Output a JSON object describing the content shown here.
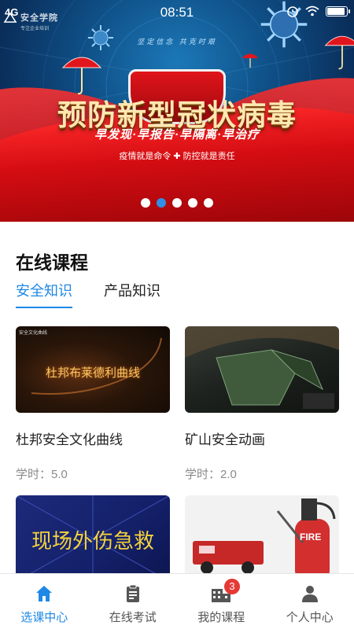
{
  "status_bar": {
    "signal": "4G",
    "time": "08:51"
  },
  "banner": {
    "logo_title": "安全学院",
    "logo_subtitle": "专注企业培训",
    "slogan_top": "坚定信念  共克时艰",
    "headline": "预防新型冠状病毒",
    "tagline": "早发现·早报告·早隔离·早治疗",
    "motto": "疫情就是命令 ✚ 防控就是责任",
    "dots": [
      false,
      true,
      false,
      false,
      false
    ]
  },
  "section": {
    "title": "在线课程",
    "tabs": [
      {
        "label": "安全知识",
        "active": true
      },
      {
        "label": "产品知识",
        "active": false
      }
    ]
  },
  "courses": [
    {
      "title": "杜邦安全文化曲线",
      "hours_label": "学时：5.0",
      "thumb_text": "杜邦布莱德利曲线",
      "thumb_small": "安全文化曲线"
    },
    {
      "title": "矿山安全动画",
      "hours_label": "学时：2.0",
      "thumb_text": "",
      "thumb_small": ""
    },
    {
      "title": "",
      "hours_label": "",
      "thumb_text": "现场外伤急救",
      "thumb_small": ""
    },
    {
      "title": "",
      "hours_label": "",
      "thumb_text": "FIRE",
      "thumb_small": ""
    }
  ],
  "bottom_nav": [
    {
      "label": "选课中心",
      "icon": "home-icon",
      "active": true
    },
    {
      "label": "在线考试",
      "icon": "clipboard-icon",
      "active": false
    },
    {
      "label": "我的课程",
      "icon": "building-icon",
      "active": false,
      "badge": "3"
    },
    {
      "label": "个人中心",
      "icon": "person-icon",
      "active": false
    }
  ],
  "colors": {
    "accent": "#1e88e5",
    "badge": "#e53935",
    "banner_red": "#d40d12"
  }
}
